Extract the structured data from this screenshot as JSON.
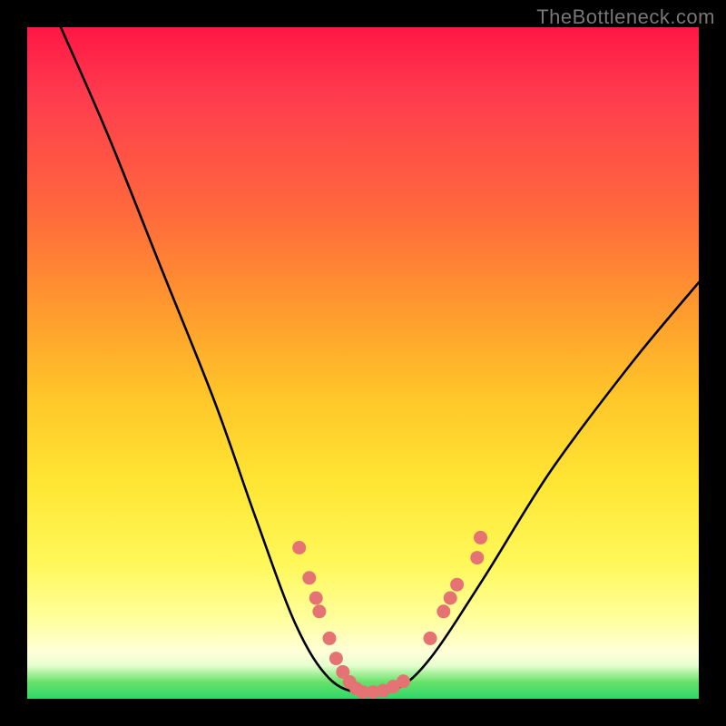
{
  "watermark": "TheBottleneck.com",
  "chart_data": {
    "type": "line",
    "title": "",
    "xlabel": "",
    "ylabel": "",
    "xlim": [
      0,
      100
    ],
    "ylim": [
      0,
      100
    ],
    "curve": {
      "points": [
        {
          "x": 5,
          "y": 100
        },
        {
          "x": 12,
          "y": 84
        },
        {
          "x": 20,
          "y": 64
        },
        {
          "x": 28,
          "y": 44
        },
        {
          "x": 34,
          "y": 27
        },
        {
          "x": 40,
          "y": 11
        },
        {
          "x": 45,
          "y": 3
        },
        {
          "x": 50,
          "y": 0.8
        },
        {
          "x": 55,
          "y": 1.5
        },
        {
          "x": 60,
          "y": 6
        },
        {
          "x": 68,
          "y": 18
        },
        {
          "x": 78,
          "y": 34
        },
        {
          "x": 90,
          "y": 50
        },
        {
          "x": 100,
          "y": 62
        }
      ]
    },
    "markers": {
      "color": "#e57373",
      "points": [
        {
          "x": 40.5,
          "y": 22.5
        },
        {
          "x": 42,
          "y": 18
        },
        {
          "x": 43,
          "y": 15
        },
        {
          "x": 43.5,
          "y": 13
        },
        {
          "x": 45,
          "y": 9
        },
        {
          "x": 46,
          "y": 6
        },
        {
          "x": 47,
          "y": 4
        },
        {
          "x": 48,
          "y": 2.5
        },
        {
          "x": 49,
          "y": 1.5
        },
        {
          "x": 50,
          "y": 1
        },
        {
          "x": 51.5,
          "y": 1
        },
        {
          "x": 53,
          "y": 1.2
        },
        {
          "x": 54.5,
          "y": 1.8
        },
        {
          "x": 56,
          "y": 2.6
        },
        {
          "x": 60,
          "y": 9
        },
        {
          "x": 62,
          "y": 13
        },
        {
          "x": 63,
          "y": 15
        },
        {
          "x": 64,
          "y": 17
        },
        {
          "x": 67,
          "y": 21
        },
        {
          "x": 67.5,
          "y": 24
        }
      ]
    }
  }
}
